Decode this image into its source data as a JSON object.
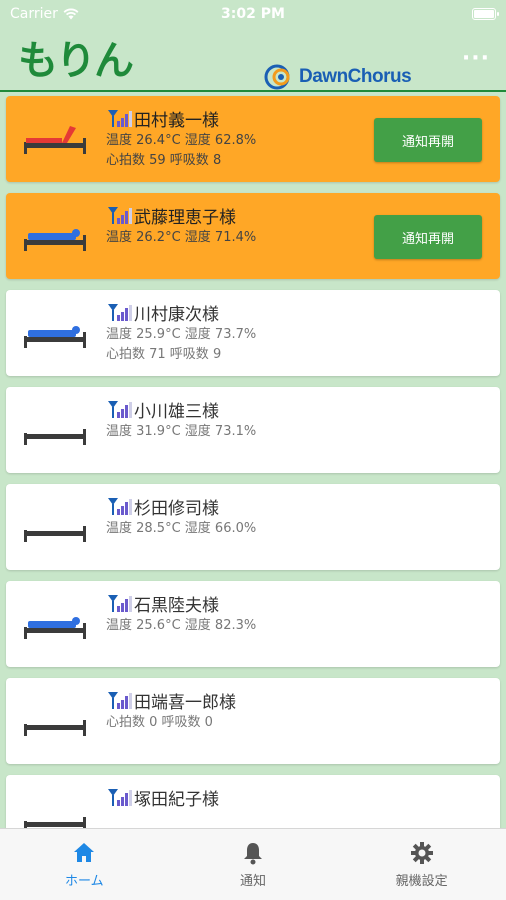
{
  "status_bar": {
    "carrier": "Carrier",
    "time": "3:02 PM"
  },
  "header": {
    "app_logo": "もりん",
    "brand_name": "DawnChorus",
    "menu_icon": "more-dots-icon"
  },
  "colors": {
    "background": "#c8e6c9",
    "alert_card": "#ffa726",
    "resume_button": "#43a047",
    "bed_sitting": "#e53935",
    "bed_occupied": "#2f6fe0",
    "bed_empty": "#3b3b3b",
    "tab_active": "#1e88e5"
  },
  "residents": [
    {
      "name": "田村義一様",
      "alert": true,
      "bed_state": "sitting",
      "env": "温度 26.4°C 湿度 62.8%",
      "vitals": "心拍数 59 呼吸数 8",
      "action_label": "通知再開"
    },
    {
      "name": "武藤理恵子様",
      "alert": true,
      "bed_state": "occupied",
      "env": "温度 26.2°C 湿度 71.4%",
      "vitals": "",
      "action_label": "通知再開"
    },
    {
      "name": "川村康次様",
      "alert": false,
      "bed_state": "occupied",
      "env": "温度 25.9°C 湿度 73.7%",
      "vitals": "心拍数 71 呼吸数 9",
      "action_label": ""
    },
    {
      "name": "小川雄三様",
      "alert": false,
      "bed_state": "empty",
      "env": "温度 31.9°C 湿度 73.1%",
      "vitals": "",
      "action_label": ""
    },
    {
      "name": "杉田修司様",
      "alert": false,
      "bed_state": "empty",
      "env": "温度 28.5°C 湿度 66.0%",
      "vitals": "",
      "action_label": ""
    },
    {
      "name": "石黒陸夫様",
      "alert": false,
      "bed_state": "occupied",
      "env": "温度 25.6°C 湿度 82.3%",
      "vitals": "",
      "action_label": ""
    },
    {
      "name": "田端喜一郎様",
      "alert": false,
      "bed_state": "empty",
      "env": "心拍数 0 呼吸数 0",
      "vitals": "",
      "action_label": ""
    },
    {
      "name": "塚田紀子様",
      "alert": false,
      "bed_state": "empty",
      "env": "",
      "vitals": "",
      "action_label": ""
    }
  ],
  "tabs": [
    {
      "label": "ホーム",
      "icon": "home-icon",
      "active": true
    },
    {
      "label": "通知",
      "icon": "bell-icon",
      "active": false
    },
    {
      "label": "親機設定",
      "icon": "gear-icon",
      "active": false
    }
  ]
}
